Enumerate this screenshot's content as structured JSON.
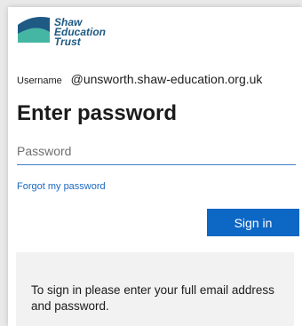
{
  "brand": {
    "logo_lines": [
      "Shaw",
      "Education",
      "Trust"
    ],
    "logo_dark": "#1e5a84",
    "logo_teal": "#45b6a3"
  },
  "account": {
    "username_label": "Username",
    "username_value": "@unsworth.shaw-education.org.uk"
  },
  "form": {
    "heading": "Enter password",
    "password_placeholder": "Password",
    "forgot_link": "Forgot my password",
    "signin_label": "Sign in"
  },
  "info": {
    "text": "To sign in please enter your full email address and password."
  },
  "colors": {
    "accent": "#0d67c5",
    "link": "#1b6ac0",
    "input_underline": "#3d7fc9"
  }
}
